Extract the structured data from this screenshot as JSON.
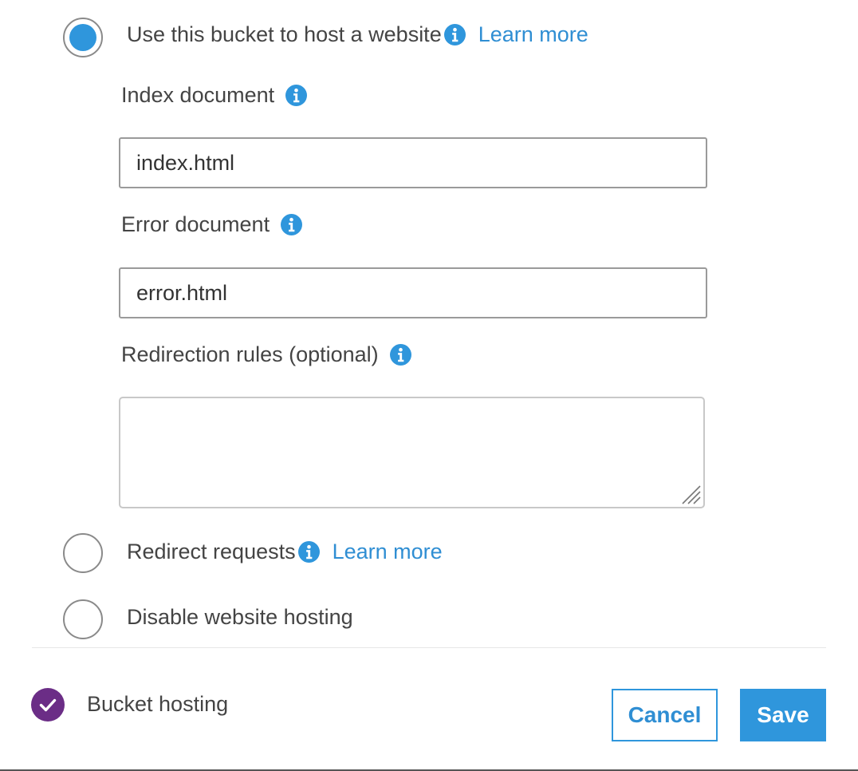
{
  "options": {
    "host_website": {
      "label": "Use this bucket to host a website",
      "link": "Learn more",
      "selected": true
    },
    "redirect": {
      "label": "Redirect requests",
      "link": "Learn more",
      "selected": false
    },
    "disable": {
      "label": "Disable website hosting",
      "selected": false
    }
  },
  "fields": {
    "index_document": {
      "label": "Index document",
      "value": "index.html"
    },
    "error_document": {
      "label": "Error document",
      "value": "error.html"
    },
    "redirection_rules": {
      "label": "Redirection rules (optional)",
      "value": ""
    }
  },
  "footer": {
    "status_label": "Bucket hosting",
    "cancel_label": "Cancel",
    "save_label": "Save"
  },
  "colors": {
    "accent": "#2f96dc",
    "link": "#2f8ed3",
    "badge": "#6b2d86",
    "text": "#444444"
  },
  "icons": {
    "info": "info-icon",
    "check": "check-icon",
    "resize": "resize-grip-icon"
  }
}
